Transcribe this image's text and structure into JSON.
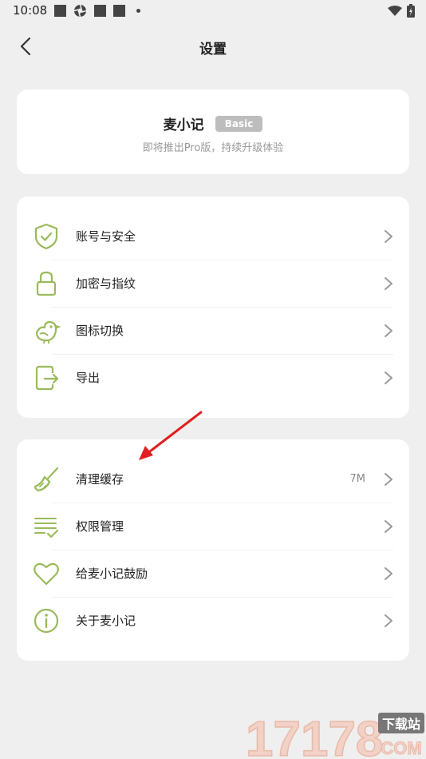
{
  "status_bar": {
    "time": "10:08"
  },
  "nav": {
    "title": "设置"
  },
  "profile": {
    "app_name": "麦小记",
    "badge": "Basic",
    "subtitle": "即将推出Pro版，持续升级体验"
  },
  "menu_group_1": [
    {
      "label": "账号与安全",
      "icon": "shield-check-icon"
    },
    {
      "label": "加密与指纹",
      "icon": "lock-icon"
    },
    {
      "label": "图标切换",
      "icon": "bird-icon"
    },
    {
      "label": "导出",
      "icon": "export-icon"
    }
  ],
  "menu_group_2": [
    {
      "label": "清理缓存",
      "value": "7M",
      "icon": "broom-icon"
    },
    {
      "label": "权限管理",
      "icon": "list-check-icon"
    },
    {
      "label": "给麦小记鼓励",
      "icon": "heart-icon"
    },
    {
      "label": "关于麦小记",
      "icon": "info-icon"
    }
  ],
  "watermark": {
    "text": "17178",
    "sub_top": "下载站",
    "sub_bottom": "COM"
  },
  "colors": {
    "accent": "#9aba5a",
    "chevron": "#999999",
    "background": "#efefef",
    "card": "#ffffff",
    "arrow": "#e02020"
  }
}
